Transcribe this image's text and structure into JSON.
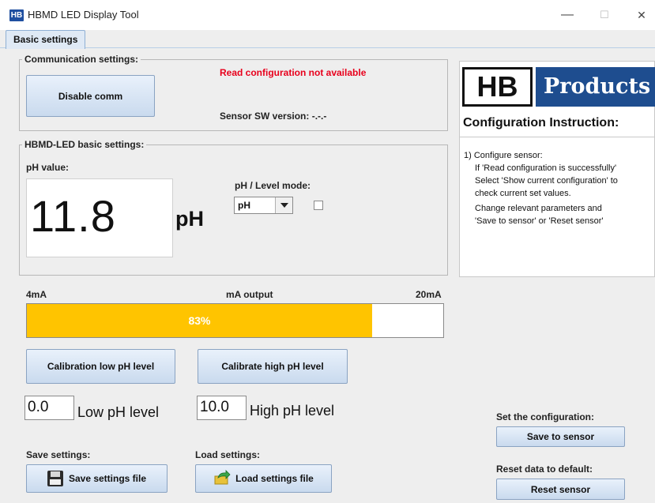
{
  "window": {
    "app_icon": "HB",
    "title": "HBMD LED Display Tool",
    "minimize_glyph": "—",
    "maximize_glyph": "☐",
    "close_glyph": "✕"
  },
  "tabs": [
    {
      "label": "Basic settings",
      "selected": true
    }
  ],
  "comm": {
    "group_title": "Communication settings:",
    "disable_button": "Disable comm",
    "status_text": "Read configuration not available",
    "status_color": "#e8001c",
    "sw_version": "Sensor SW version: -.-.-"
  },
  "basic": {
    "group_title": "HBMD-LED basic settings:",
    "ph_value_label": "pH value:",
    "ph_value": "11.8",
    "ph_unit": "pH",
    "mode_label": "pH / Level mode:",
    "mode_selected": "pH",
    "mode_checkbox_checked": false
  },
  "output": {
    "low_label": "4mA",
    "title": "mA output",
    "high_label": "20mA",
    "percent": 83,
    "percent_text": "83%",
    "bar_color": "#ffc400"
  },
  "calibration": {
    "low_button": "Calibration low pH level",
    "high_button": "Calibrate high pH level",
    "low_value": "0.0",
    "low_label": "Low pH level",
    "high_value": "10.0",
    "high_label": "High pH level"
  },
  "files": {
    "save_label": "Save settings:",
    "save_button": "Save settings file",
    "save_icon": "floppy-disk-icon",
    "load_label": "Load settings:",
    "load_button": "Load settings file",
    "load_icon": "load-arrow-icon"
  },
  "info": {
    "logo_left": "HB",
    "logo_right": "Products",
    "title": "Configuration Instruction:",
    "lines": [
      "1) Configure sensor:",
      "If 'Read configuration is successfully'",
      "Select 'Show current configuration' to",
      "check current set values.",
      "Change relevant parameters and",
      "'Save to sensor' or 'Reset sensor'"
    ]
  },
  "sensor": {
    "set_label": "Set the configuration:",
    "save_button": "Save to sensor",
    "reset_label": "Reset data to default:",
    "reset_button": "Reset sensor"
  }
}
